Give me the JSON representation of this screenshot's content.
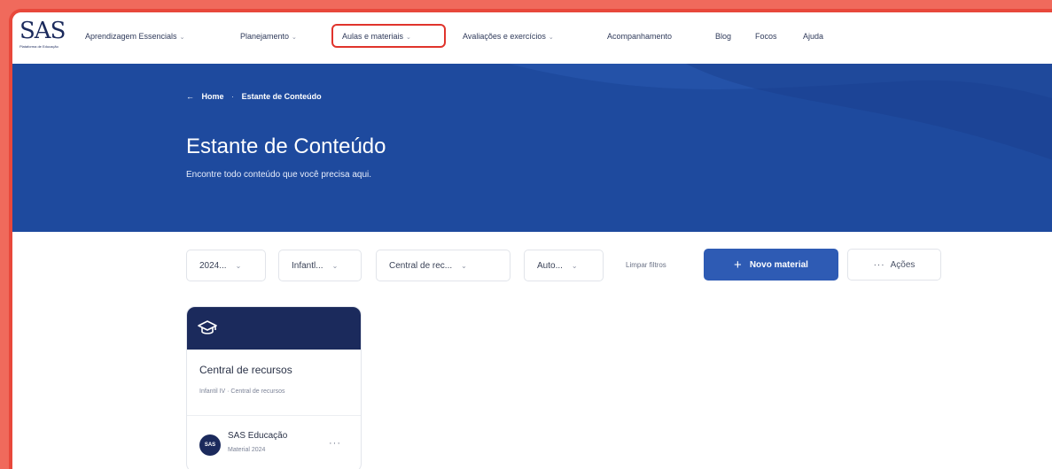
{
  "logo": {
    "text": "SAS",
    "subtitle": "Plataforma de Educação"
  },
  "nav": {
    "items": [
      {
        "label": "Aprendizagem Essencials",
        "has_dropdown": true
      },
      {
        "label": "Planejamento",
        "has_dropdown": true
      },
      {
        "label": "Aulas e materiais",
        "has_dropdown": true,
        "highlighted": true
      },
      {
        "label": "Avaliações e exercícios",
        "has_dropdown": true
      },
      {
        "label": "Acompanhamento",
        "has_dropdown": false
      },
      {
        "label": "Blog",
        "has_dropdown": false
      },
      {
        "label": "Focos",
        "has_dropdown": false
      },
      {
        "label": "Ajuda",
        "has_dropdown": false
      }
    ]
  },
  "breadcrumb": {
    "back_icon": "arrow-left-icon",
    "home": "Home",
    "separator": "·",
    "current": "Estante de Conteúdo"
  },
  "hero": {
    "title": "Estante de Conteúdo",
    "subtitle": "Encontre todo conteúdo que você precisa aqui."
  },
  "filters": [
    {
      "value": "2024..."
    },
    {
      "value": "Infantl..."
    },
    {
      "value": "Central de rec..."
    },
    {
      "value": "Auto..."
    }
  ],
  "clear_filters": "Limpar filtros",
  "new_material": {
    "label": "Novo material",
    "icon": "plus-icon"
  },
  "actions": {
    "label": "Ações",
    "icon": "more-horizontal-icon",
    "dots": "···"
  },
  "card": {
    "icon": "graduation-cap-icon",
    "title": "Central de recursos",
    "tags": "Infantil IV · Central de recursos",
    "author": "SAS Educação",
    "meta": "Material 2024",
    "avatar_text": "SAS",
    "more": "···"
  },
  "colors": {
    "background": "#f06a5c",
    "frame_border": "#e8483b",
    "hero_blue": "#1e4a9e",
    "primary_button": "#2e5bb4",
    "card_header": "#1b2a5c",
    "highlight": "#e0342c"
  }
}
